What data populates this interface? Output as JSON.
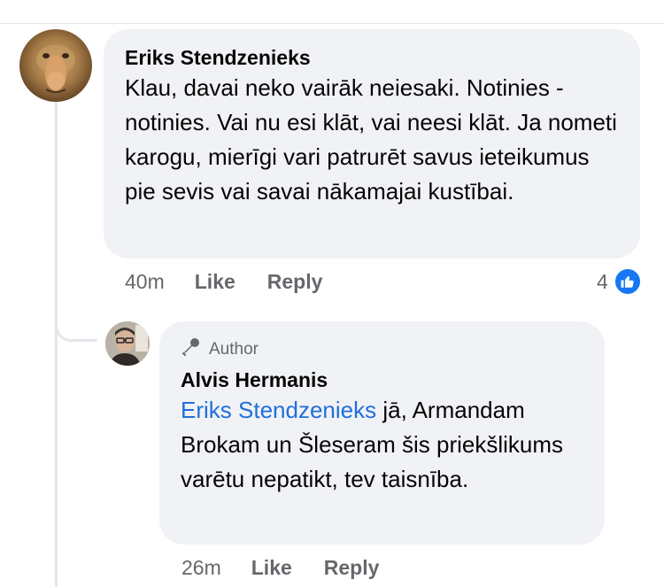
{
  "comment": {
    "author": "Eriks Stendzenieks",
    "text": "Klau, davai neko vairāk neiesaki. Notinies - notinies. Vai nu esi klāt, vai neesi klāt. Ja nometi karogu, mierīgi vari patrurēt savus ieteikumus pie sevis vai savai nākamajai kustībai.",
    "time": "40m",
    "like_label": "Like",
    "reply_label": "Reply",
    "reaction_count": "4",
    "reaction_icon": "thumbs-up-icon",
    "accent_color": "#1877f2"
  },
  "reply": {
    "badge": "Author",
    "badge_icon": "microphone-icon",
    "author": "Alvis Hermanis",
    "mention": "Eriks Stendzenieks",
    "text": " jā, Armandam Brokam un Šleseram šis priekšlikums varētu nepatikt, tev taisnība.",
    "time": "26m",
    "like_label": "Like",
    "reply_label": "Reply",
    "mention_color": "#216fdb"
  }
}
